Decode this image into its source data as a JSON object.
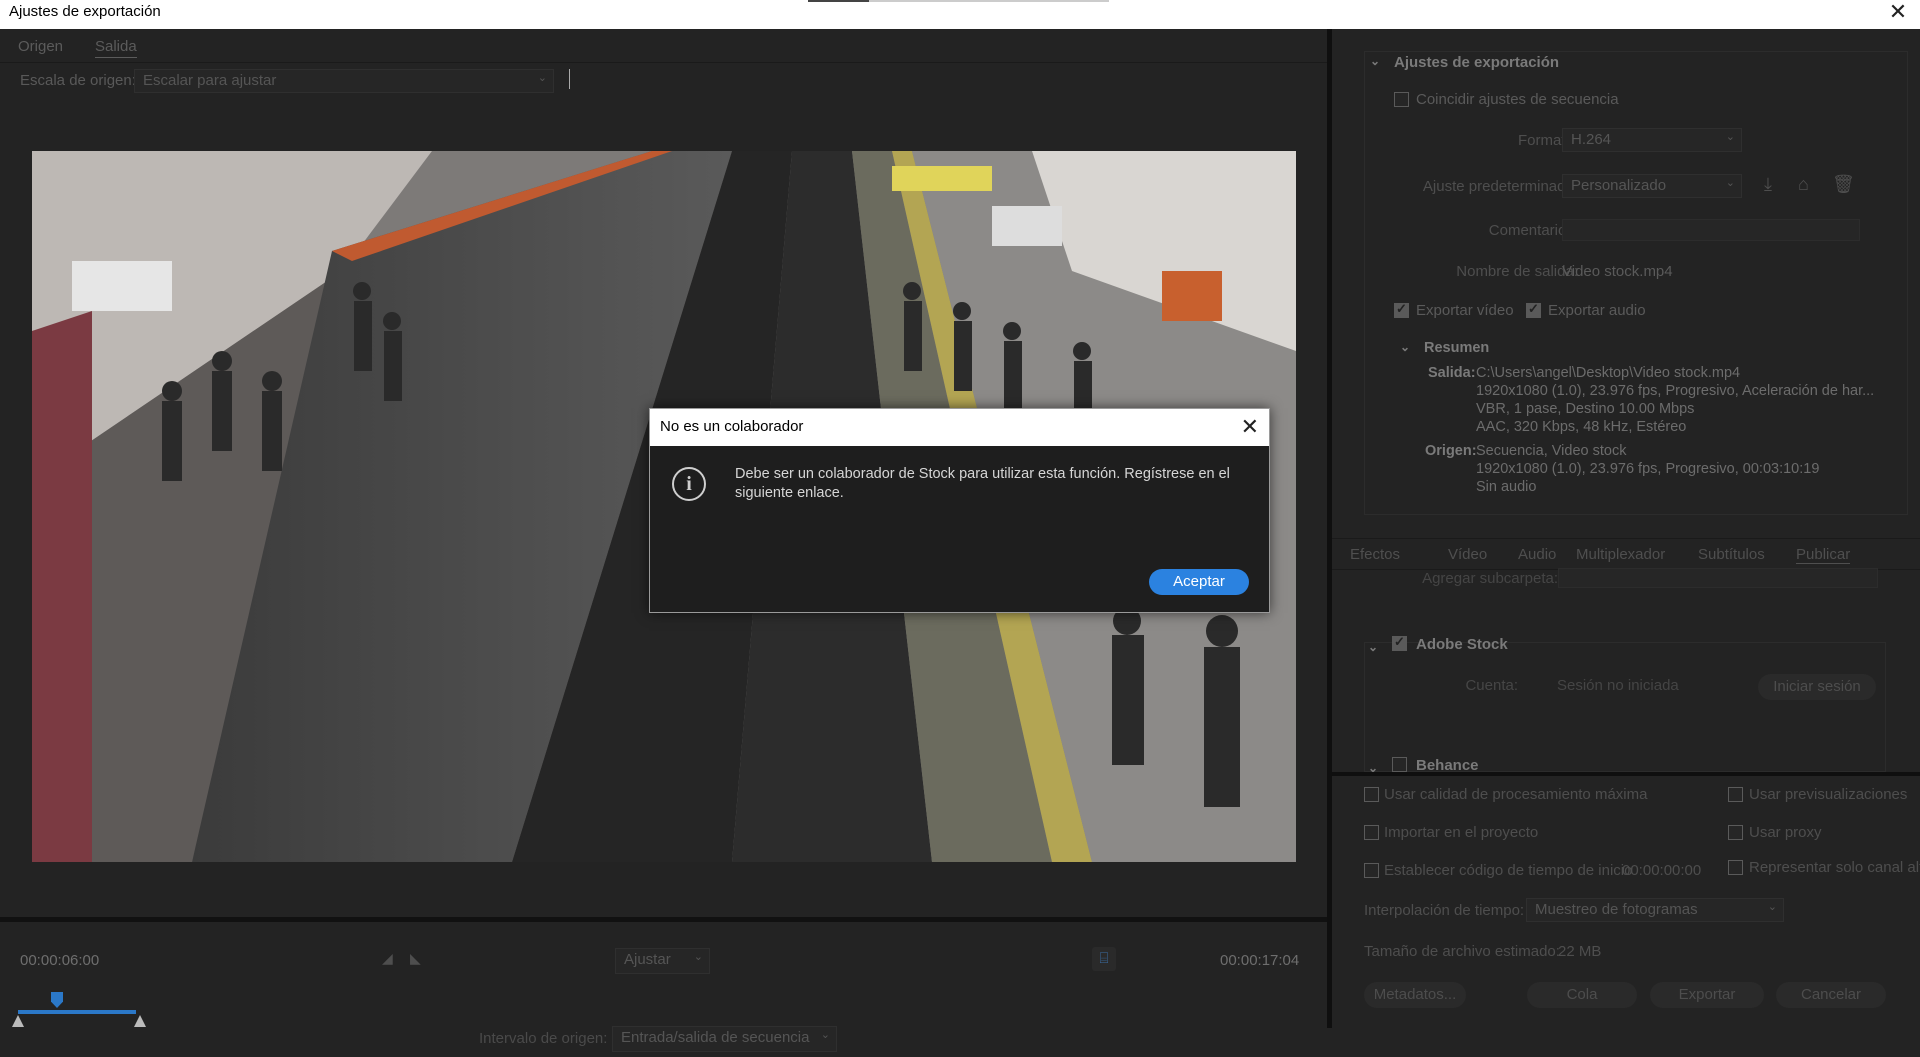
{
  "window": {
    "title": "Ajustes de exportación",
    "close": "✕"
  },
  "left": {
    "tabs": [
      "Origen",
      "Salida"
    ],
    "scale_label": "Escala de origen:",
    "scale_value": "Escalar para ajustar",
    "timecode_in": "00:00:06:00",
    "timecode_out": "00:00:17:04",
    "fit_value": "Ajustar",
    "range_label": "Intervalo de origen:",
    "range_value": "Entrada/salida de secuencia"
  },
  "export": {
    "section_title": "Ajustes de exportación",
    "match_sequence": "Coincidir ajustes de secuencia",
    "format_label": "Formato:",
    "format_value": "H.264",
    "preset_label": "Ajuste predeterminado:",
    "preset_value": "Personalizado",
    "comments_label": "Comentarios:",
    "output_name_label": "Nombre de salida:",
    "output_name_value": "Video stock.mp4",
    "export_video": "Exportar vídeo",
    "export_audio": "Exportar audio",
    "summary_title": "Resumen",
    "output_label": "Salida:",
    "output_lines": [
      "C:\\Users\\angel\\Desktop\\Video stock.mp4",
      "1920x1080 (1.0), 23.976 fps, Progresivo,  Aceleración de har...",
      "VBR, 1 pase, Destino 10.00 Mbps",
      "AAC, 320 Kbps, 48 kHz, Estéreo"
    ],
    "source_label": "Origen:",
    "source_lines": [
      "Secuencia, Video stock",
      "1920x1080 (1.0), 23.976 fps, Progresivo, 00:03:10:19",
      "Sin audio"
    ]
  },
  "subtabs": [
    "Efectos",
    "Vídeo",
    "Audio",
    "Multiplexador",
    "Subtítulos",
    "Publicar"
  ],
  "publish": {
    "subfolder_label": "Agregar subcarpeta:",
    "adobe_stock": "Adobe Stock",
    "account_label": "Cuenta:",
    "account_value": "Sesión no iniciada",
    "signin_button": "Iniciar sesión",
    "behance": "Behance"
  },
  "options": {
    "max_quality": "Usar calidad de procesamiento máxima",
    "use_previews": "Usar previsualizaciones",
    "import_project": "Importar en el proyecto",
    "use_proxy": "Usar proxy",
    "set_timecode": "Establecer código de tiempo de inicio",
    "timecode_value": "00:00:00:00",
    "alpha_only": "Representar solo canal alfa",
    "interp_label": "Interpolación de tiempo:",
    "interp_value": "Muestreo de fotogramas",
    "filesize_label": "Tamaño de archivo estimado:",
    "filesize_value": "22 MB"
  },
  "buttons": {
    "metadata": "Metadatos...",
    "queue": "Cola",
    "export": "Exportar",
    "cancel": "Cancelar"
  },
  "dialog": {
    "title": "No es un colaborador",
    "close": "✕",
    "icon": "i",
    "message": "Debe ser un colaborador de Stock para utilizar esta función. Regístrese en el siguiente enlace.",
    "ok": "Aceptar"
  }
}
